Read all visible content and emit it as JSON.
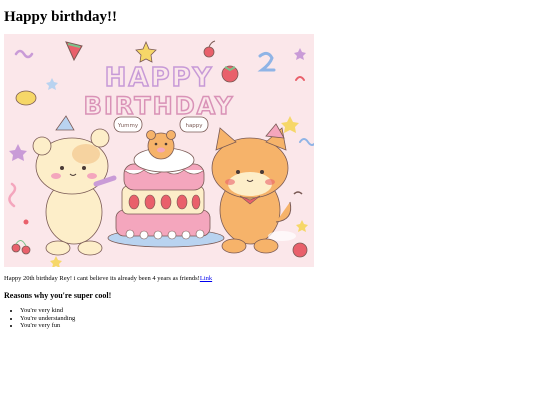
{
  "heading": "Happy birthday!!",
  "banner": {
    "line1": "HAPPY",
    "line2": "BIRTHDAY",
    "tag_left": "Yummy",
    "tag_right": "happy",
    "palette": {
      "background": "#fbe7ea",
      "pink": "#f4a6bd",
      "cream": "#fdeec9",
      "orange": "#f6b36a",
      "blue": "#b9d3f0",
      "yellow": "#f6d768",
      "red": "#e9606b",
      "green": "#7cc28a",
      "outline": "#7a5a55"
    }
  },
  "intro": {
    "text": "Happy 20th birthday Rey! i cant believe its already been 4 years as friends!",
    "link_label": "Link"
  },
  "reasons": {
    "heading": "Reasons why you're super cool!",
    "items": [
      "You're very kind",
      "You're understanding",
      "You're very fun"
    ]
  }
}
